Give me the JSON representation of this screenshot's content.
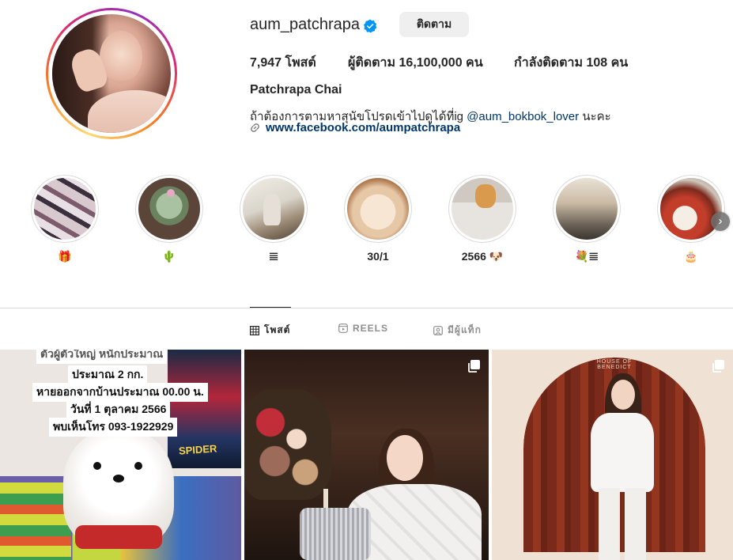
{
  "profile": {
    "username": "aum_patchrapa",
    "follow_label": "ติดตาม",
    "posts": "7,947 โพสต์",
    "followers": "ผู้ติดตาม 16,100,000 คน",
    "following": "กำลังติดตาม 108 คน",
    "full_name": "Patchrapa Chai",
    "bio_text": "ถ้าต้องการตามหาสุนัขโปรดเข้าไปดูได้ที่ig ",
    "bio_mention": "@aum_bokbok_lover",
    "bio_suffix": " นะคะ",
    "link": "www.facebook.com/aumpatchrapa"
  },
  "highlights": [
    {
      "label": "🎁"
    },
    {
      "label": "🌵"
    },
    {
      "label": "𝌆"
    },
    {
      "label": "30/1"
    },
    {
      "label": "2566 🐶"
    },
    {
      "label": "💐𝌆"
    },
    {
      "label": "🎂"
    }
  ],
  "tabs": [
    {
      "label": "โพสต์",
      "icon": "grid-icon",
      "active": true
    },
    {
      "label": "REELS",
      "icon": "reels-icon",
      "active": false
    },
    {
      "label": "มีผู้แท็ก",
      "icon": "tagged-icon",
      "active": false
    }
  ],
  "posts": [
    {
      "overlay_lines": [
        "ตัวผู้ตัวใหญ่ หนักประมาณ",
        "ประมาณ 2 กก.",
        "หายออกจากบ้านประมาณ 00.00 น.",
        "วันที่ 1 ตุลาคม 2566",
        "พบเห็นโทร 093-1922929"
      ],
      "poster_text": "SPIDER"
    },
    {
      "multi": true
    },
    {
      "multi": true,
      "banner": "HOUSE OF BENEDICT"
    }
  ],
  "colors": {
    "link": "#00376b",
    "verified": "#0095f6",
    "button_bg": "#efefef"
  }
}
